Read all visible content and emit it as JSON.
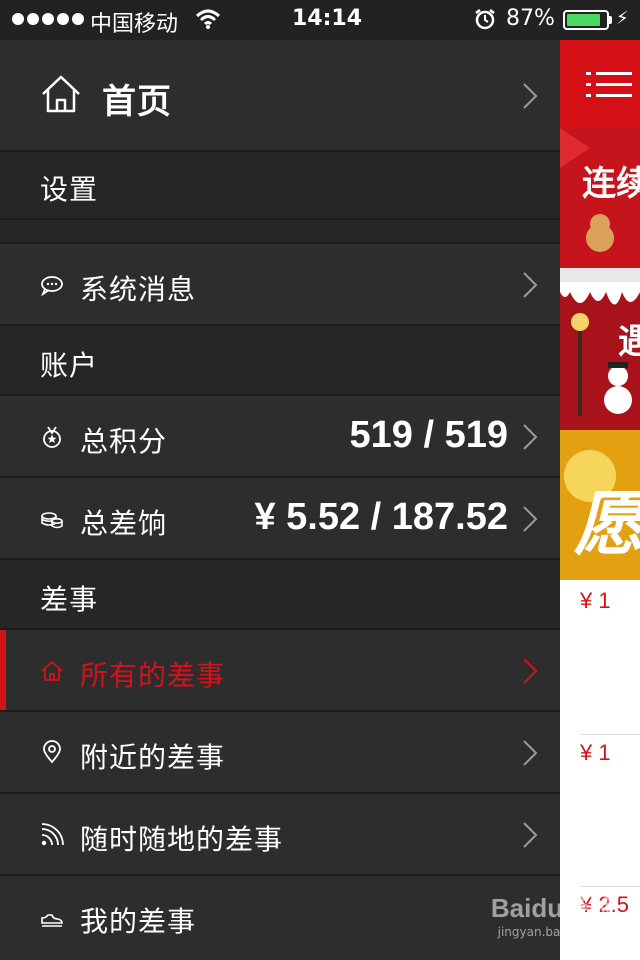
{
  "status_bar": {
    "carrier": "中国移动",
    "time": "14:14",
    "battery_percent": "87%",
    "battery_level": 0.87,
    "icons": [
      "signal-dots-icon",
      "wifi-icon",
      "alarm-icon",
      "battery-icon",
      "charging-bolt-icon"
    ]
  },
  "menu": {
    "home": {
      "label": "首页",
      "icon": "home-icon"
    },
    "settings_header": "设置",
    "system_messages": {
      "label": "系统消息",
      "icon": "chat-bubble-icon"
    },
    "account_header": "账户",
    "total_points": {
      "label": "总积分",
      "value": "519 / 519",
      "icon": "medal-icon"
    },
    "total_earnings": {
      "label": "总差饷",
      "value": "¥ 5.52 / 187.52",
      "icon": "coins-icon"
    },
    "tasks_header": "差事",
    "all_tasks": {
      "label": "所有的差事",
      "icon": "home-icon",
      "active": true
    },
    "nearby_tasks": {
      "label": "附近的差事",
      "icon": "location-pin-icon"
    },
    "anytime_tasks": {
      "label": "随时随地的差事",
      "icon": "rss-icon"
    },
    "my_tasks": {
      "label": "我的差事",
      "icon": "shoe-icon"
    }
  },
  "peek": {
    "banner_texts": [
      "连续",
      "遇",
      "愿"
    ],
    "prices": [
      "¥ 1",
      "¥ 1",
      "¥ 2.5"
    ]
  },
  "colors": {
    "accent_red": "#d3131c",
    "menu_bg": "#2d2d2d",
    "section_bg": "#262626",
    "battery_green": "#4cd964"
  },
  "watermark": {
    "brand": "Baidu经验",
    "url": "jingyan.baidu.com"
  }
}
